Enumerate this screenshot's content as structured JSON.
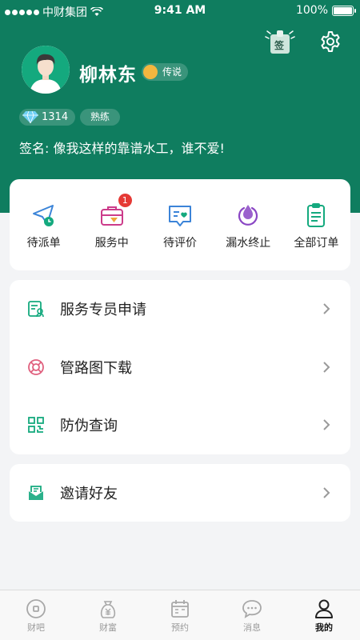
{
  "status_bar": {
    "carrier": "中财集团",
    "time": "9:41 AM",
    "battery": "100%"
  },
  "header": {
    "sign_label": "签",
    "username": "柳林东",
    "level": "传说",
    "diamonds": "1314",
    "skill": "熟练",
    "signature": "签名: 像我这样的靠谱水工，谁不爱!"
  },
  "orders": [
    {
      "label": "待派单"
    },
    {
      "label": "服务中",
      "count": "1"
    },
    {
      "label": "待评价"
    },
    {
      "label": "漏水终止"
    },
    {
      "label": "全部订单"
    }
  ],
  "menu": [
    {
      "label": "服务专员申请"
    },
    {
      "label": "管路图下载"
    },
    {
      "label": "防伪查询"
    }
  ],
  "invite": {
    "label": "邀请好友"
  },
  "tabs": [
    {
      "label": "财吧"
    },
    {
      "label": "财富"
    },
    {
      "label": "预约"
    },
    {
      "label": "消息"
    },
    {
      "label": "我的"
    }
  ],
  "colors": {
    "brand": "#0f7d5f",
    "badge": "#e53935"
  }
}
